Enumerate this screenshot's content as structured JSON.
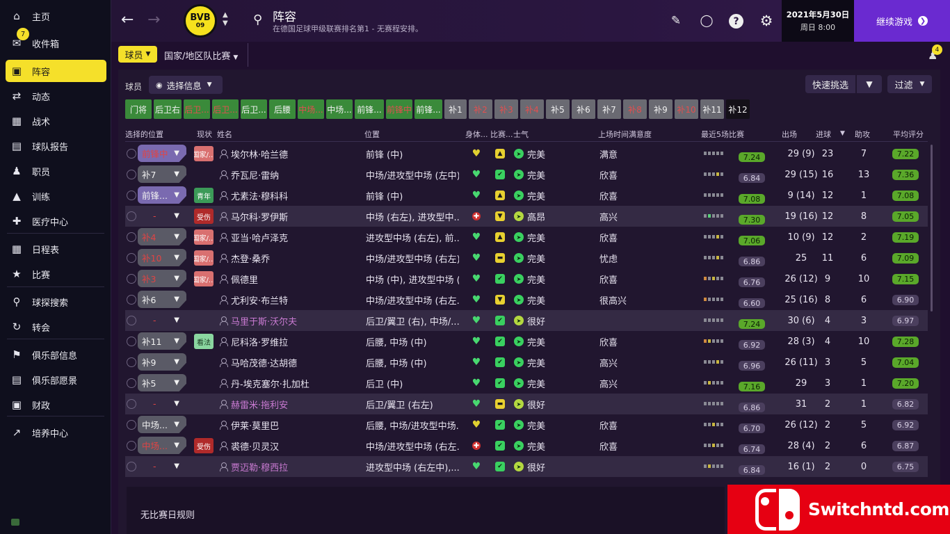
{
  "sidebar": {
    "items": [
      {
        "label": "主页",
        "icon": "home-icon"
      },
      {
        "label": "收件箱",
        "icon": "inbox-icon",
        "badge": "7"
      },
      {
        "label": "阵容",
        "icon": "squad-icon",
        "active": true
      },
      {
        "label": "动态",
        "icon": "dynamics-icon"
      },
      {
        "label": "战术",
        "icon": "tactics-icon"
      },
      {
        "label": "球队报告",
        "icon": "report-icon"
      },
      {
        "label": "职员",
        "icon": "staff-icon"
      },
      {
        "label": "训练",
        "icon": "training-icon"
      },
      {
        "label": "医疗中心",
        "icon": "medical-icon"
      },
      {
        "label": "日程表",
        "icon": "calendar-icon"
      },
      {
        "label": "比赛",
        "icon": "trophy-icon"
      },
      {
        "label": "球探搜索",
        "icon": "scouting-icon"
      },
      {
        "label": "转会",
        "icon": "transfer-icon"
      },
      {
        "label": "俱乐部信息",
        "icon": "club-info-icon"
      },
      {
        "label": "俱乐部愿景",
        "icon": "club-vision-icon"
      },
      {
        "label": "财政",
        "icon": "finance-icon"
      },
      {
        "label": "培养中心",
        "icon": "development-icon"
      }
    ]
  },
  "header": {
    "club_logo_line1": "BVB",
    "club_logo_line2": "09",
    "title": "阵容",
    "subtitle": "在德国足球甲级联赛排名第1 - 无赛程安排。",
    "date": "2021年5月30日",
    "day_time": "周日 8:00",
    "continue_label": "继续游戏",
    "people_badge": "4"
  },
  "subnav": {
    "players": "球员",
    "national": "国家/地区队比赛"
  },
  "toolbar": {
    "players_label": "球员",
    "select_info": "选择信息",
    "quick_pick": "快速挑选",
    "filter": "过滤"
  },
  "position_chips": [
    {
      "label": "门将",
      "style": "green"
    },
    {
      "label": "后卫右",
      "style": "green"
    },
    {
      "label": "后卫...",
      "style": "green bad"
    },
    {
      "label": "后卫...",
      "style": "green bad"
    },
    {
      "label": "后卫...",
      "style": "green"
    },
    {
      "label": "后腰",
      "style": "green"
    },
    {
      "label": "中场...",
      "style": "green bad"
    },
    {
      "label": "中场...",
      "style": "green"
    },
    {
      "label": "前锋...",
      "style": "green"
    },
    {
      "label": "前锋中",
      "style": "green bad"
    },
    {
      "label": "前锋...",
      "style": "green"
    },
    {
      "label": "补1",
      "style": "gray"
    },
    {
      "label": "补2",
      "style": "gray bad"
    },
    {
      "label": "补3",
      "style": "gray bad"
    },
    {
      "label": "补4",
      "style": "gray bad"
    },
    {
      "label": "补5",
      "style": "gray"
    },
    {
      "label": "补6",
      "style": "gray"
    },
    {
      "label": "补7",
      "style": "gray"
    },
    {
      "label": "补8",
      "style": "gray bad"
    },
    {
      "label": "补9",
      "style": "gray"
    },
    {
      "label": "补10",
      "style": "gray bad"
    },
    {
      "label": "补11",
      "style": "gray"
    },
    {
      "label": "补12",
      "style": "dark"
    }
  ],
  "table": {
    "headers": {
      "selected_position": "选择的位置",
      "status": "现状",
      "name": "姓名",
      "position": "位置",
      "condition": "身体...",
      "match_sharpness": "比赛...",
      "morale": "士气",
      "playing_time": "上场时间满意度",
      "form": "最近5场比赛",
      "apps": "出场",
      "goals": "进球",
      "assists": "助攻",
      "avg_rating": "平均评分"
    },
    "rows": [
      {
        "sel": "前锋中",
        "sel_style": "purple bad",
        "status": "国家/...",
        "status_style": "nat",
        "name": "埃尔林·哈兰德",
        "loan": false,
        "position": "前锋 (中)",
        "cond": "yellow",
        "sharp": "^",
        "sharp_style": "",
        "morale_icon": "",
        "morale": "完美",
        "satisfaction": "满意",
        "form": [
          "g",
          "g",
          "g",
          "g",
          "g"
        ],
        "form_rating": "7.24",
        "form_good": true,
        "apps": "29 (9)",
        "goals": "23",
        "assists": "7",
        "avg": "7.22",
        "avg_good": true,
        "hl": false
      },
      {
        "sel": "补7",
        "sel_style": "",
        "status": "",
        "status_style": "",
        "name": "乔瓦尼·雷纳",
        "loan": false,
        "position": "中场/进攻型中场 (左中)",
        "cond": "green",
        "sharp": "👍",
        "sharp_style": "green",
        "morale_icon": "",
        "morale": "完美",
        "satisfaction": "欣喜",
        "form": [
          "g",
          "g",
          "g",
          "y",
          "g"
        ],
        "form_rating": "6.84",
        "form_good": false,
        "apps": "29 (15)",
        "goals": "16",
        "assists": "13",
        "avg": "7.36",
        "avg_good": true,
        "hl": false
      },
      {
        "sel": "前锋...",
        "sel_style": "purple",
        "status": "青年",
        "status_style": "youth",
        "name": "尤素法·穆科科",
        "loan": false,
        "position": "前锋 (中)",
        "cond": "green",
        "sharp": "^",
        "sharp_style": "",
        "morale_icon": "",
        "morale": "完美",
        "satisfaction": "欣喜",
        "form": [
          "g",
          "g",
          "g",
          "g",
          "g"
        ],
        "form_rating": "7.08",
        "form_good": true,
        "apps": "9 (14)",
        "goals": "12",
        "assists": "1",
        "avg": "7.08",
        "avg_good": true,
        "hl": false
      },
      {
        "sel": "-",
        "sel_style": "dark bad",
        "status": "受伤",
        "status_style": "inj",
        "name": "马尔科·罗伊斯",
        "loan": false,
        "position": "中场 (右左), 进攻型中...",
        "cond": "red",
        "sharp": "v",
        "sharp_style": "",
        "morale_icon": "yellow",
        "morale": "高昂",
        "satisfaction": "高兴",
        "form": [
          "g",
          "lg",
          "g",
          "g",
          "g"
        ],
        "form_rating": "7.30",
        "form_good": true,
        "apps": "19 (16)",
        "goals": "12",
        "assists": "8",
        "avg": "7.05",
        "avg_good": true,
        "hl": true
      },
      {
        "sel": "补4",
        "sel_style": "bad",
        "status": "国家/...",
        "status_style": "nat",
        "name": "亚当·哈卢泽克",
        "loan": false,
        "position": "进攻型中场 (右左), 前...",
        "cond": "green",
        "sharp": "^",
        "sharp_style": "",
        "morale_icon": "",
        "morale": "完美",
        "satisfaction": "欣喜",
        "form": [
          "g",
          "g",
          "g",
          "y",
          "g"
        ],
        "form_rating": "7.06",
        "form_good": true,
        "apps": "10 (9)",
        "goals": "12",
        "assists": "2",
        "avg": "7.19",
        "avg_good": true,
        "hl": false
      },
      {
        "sel": "补10",
        "sel_style": "bad",
        "status": "国家/...",
        "status_style": "nat",
        "name": "杰登·桑乔",
        "loan": false,
        "position": "中场/进攻型中场 (右左)",
        "cond": "green",
        "sharp": "-",
        "sharp_style": "",
        "morale_icon": "",
        "morale": "完美",
        "satisfaction": "忧虑",
        "form": [
          "g",
          "g",
          "g",
          "y",
          "g"
        ],
        "form_rating": "6.86",
        "form_good": false,
        "apps": "25",
        "goals": "11",
        "assists": "6",
        "avg": "7.09",
        "avg_good": true,
        "hl": false
      },
      {
        "sel": "补3",
        "sel_style": "bad",
        "status": "国家/...",
        "status_style": "nat",
        "name": "佩德里",
        "loan": false,
        "position": "中场 (中), 进攻型中场 (...",
        "cond": "green",
        "sharp": "👍",
        "sharp_style": "green",
        "morale_icon": "",
        "morale": "完美",
        "satisfaction": "欣喜",
        "form": [
          "o",
          "g",
          "y",
          "g",
          "g"
        ],
        "form_rating": "6.76",
        "form_good": false,
        "apps": "26 (12)",
        "goals": "9",
        "assists": "10",
        "avg": "7.15",
        "avg_good": true,
        "hl": false
      },
      {
        "sel": "补6",
        "sel_style": "",
        "status": "",
        "status_style": "",
        "name": "尤利安·布兰特",
        "loan": false,
        "position": "中场/进攻型中场 (右左...",
        "cond": "green",
        "sharp": "v",
        "sharp_style": "",
        "morale_icon": "",
        "morale": "完美",
        "satisfaction": "很高兴",
        "form": [
          "o",
          "g",
          "g",
          "g",
          "g"
        ],
        "form_rating": "6.60",
        "form_good": false,
        "apps": "25 (16)",
        "goals": "8",
        "assists": "6",
        "avg": "6.90",
        "avg_good": false,
        "hl": false
      },
      {
        "sel": "-",
        "sel_style": "dark bad",
        "status": "",
        "status_style": "",
        "name": "马里于斯·沃尔夫",
        "loan": true,
        "position": "后卫/翼卫 (右), 中场/...",
        "cond": "green",
        "sharp": "👍",
        "sharp_style": "green",
        "morale_icon": "yellow",
        "morale": "很好",
        "satisfaction": "",
        "form": [
          "g",
          "g",
          "g",
          "g",
          "g"
        ],
        "form_rating": "7.24",
        "form_good": true,
        "apps": "30 (6)",
        "goals": "4",
        "assists": "3",
        "avg": "6.97",
        "avg_good": false,
        "hl": true
      },
      {
        "sel": "补11",
        "sel_style": "",
        "status": "看法",
        "status_style": "watch",
        "name": "尼科洛·罗维拉",
        "loan": false,
        "position": "后腰, 中场 (中)",
        "cond": "green",
        "sharp": "👍",
        "sharp_style": "green",
        "morale_icon": "",
        "morale": "完美",
        "satisfaction": "欣喜",
        "form": [
          "o",
          "y",
          "g",
          "g",
          "g"
        ],
        "form_rating": "6.92",
        "form_good": false,
        "apps": "28 (3)",
        "goals": "4",
        "assists": "10",
        "avg": "7.28",
        "avg_good": true,
        "hl": false
      },
      {
        "sel": "补9",
        "sel_style": "",
        "status": "",
        "status_style": "",
        "name": "马哈茂德·达胡德",
        "loan": false,
        "position": "后腰, 中场 (中)",
        "cond": "green",
        "sharp": "👍",
        "sharp_style": "green",
        "morale_icon": "",
        "morale": "完美",
        "satisfaction": "高兴",
        "form": [
          "g",
          "g",
          "g",
          "y",
          "g"
        ],
        "form_rating": "6.96",
        "form_good": false,
        "apps": "26 (11)",
        "goals": "3",
        "assists": "5",
        "avg": "7.04",
        "avg_good": true,
        "hl": false
      },
      {
        "sel": "补5",
        "sel_style": "",
        "status": "",
        "status_style": "",
        "name": "丹-埃克塞尔·扎加杜",
        "loan": false,
        "position": "后卫 (中)",
        "cond": "green",
        "sharp": "👍",
        "sharp_style": "green",
        "morale_icon": "",
        "morale": "完美",
        "satisfaction": "高兴",
        "form": [
          "g",
          "y",
          "g",
          "g",
          "g"
        ],
        "form_rating": "7.16",
        "form_good": true,
        "apps": "29",
        "goals": "3",
        "assists": "1",
        "avg": "7.20",
        "avg_good": true,
        "hl": false
      },
      {
        "sel": "-",
        "sel_style": "dark bad",
        "status": "",
        "status_style": "",
        "name": "赫雷米·拖利安",
        "loan": true,
        "position": "后卫/翼卫 (右左)",
        "cond": "green",
        "sharp": "-",
        "sharp_style": "",
        "morale_icon": "yellow",
        "morale": "很好",
        "satisfaction": "",
        "form": [
          "g",
          "g",
          "g",
          "g",
          "g"
        ],
        "form_rating": "6.86",
        "form_good": false,
        "apps": "31",
        "goals": "2",
        "assists": "1",
        "avg": "6.82",
        "avg_good": false,
        "hl": true
      },
      {
        "sel": "中场...",
        "sel_style": "",
        "status": "",
        "status_style": "",
        "name": "伊莱·莫里巴",
        "loan": false,
        "position": "后腰, 中场/进攻型中场...",
        "cond": "yellow",
        "sharp": "👍",
        "sharp_style": "green",
        "morale_icon": "",
        "morale": "完美",
        "satisfaction": "欣喜",
        "form": [
          "g",
          "g",
          "y",
          "g",
          "g"
        ],
        "form_rating": "6.70",
        "form_good": false,
        "apps": "26 (12)",
        "goals": "2",
        "assists": "5",
        "avg": "6.92",
        "avg_good": false,
        "hl": false
      },
      {
        "sel": "中场...",
        "sel_style": "bad",
        "status": "受伤",
        "status_style": "inj",
        "name": "裘德·贝灵汉",
        "loan": false,
        "position": "中场/进攻型中场 (右左...",
        "cond": "red",
        "sharp": "👍",
        "sharp_style": "green",
        "morale_icon": "",
        "morale": "完美",
        "satisfaction": "欣喜",
        "form": [
          "g",
          "g",
          "y",
          "g",
          "g"
        ],
        "form_rating": "6.74",
        "form_good": false,
        "apps": "28 (4)",
        "goals": "2",
        "assists": "6",
        "avg": "6.87",
        "avg_good": false,
        "hl": false
      },
      {
        "sel": "-",
        "sel_style": "dark bad",
        "status": "",
        "status_style": "",
        "name": "贾迈勒·穆西拉",
        "loan": true,
        "position": "进攻型中场 (右左中),...",
        "cond": "green",
        "sharp": "👍",
        "sharp_style": "green",
        "morale_icon": "yellow",
        "morale": "很好",
        "satisfaction": "",
        "form": [
          "g",
          "y",
          "g",
          "g",
          "g"
        ],
        "form_rating": "6.84",
        "form_good": false,
        "apps": "16 (1)",
        "goals": "2",
        "assists": "0",
        "avg": "6.75",
        "avg_good": false,
        "hl": true
      }
    ]
  },
  "footer": {
    "no_match_rules": "无比赛日规则"
  },
  "watermark": {
    "text": "Switchntd.com"
  }
}
